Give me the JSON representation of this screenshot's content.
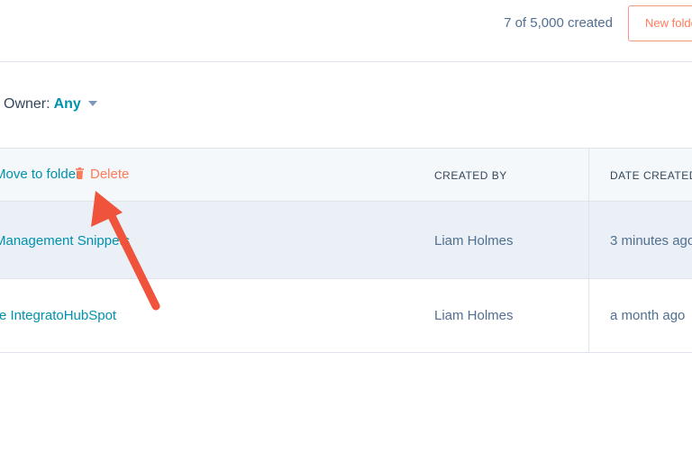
{
  "header": {
    "created_count": "7 of 5,000 created",
    "new_folder_label": "New folder"
  },
  "filters": {
    "owner_label": "Owner:",
    "owner_value": "Any"
  },
  "bulk_actions": {
    "move_to_folder_label": "Move to folder",
    "delete_label": "Delete"
  },
  "table": {
    "columns": [
      "CREATED BY",
      "DATE CREATED"
    ],
    "rows": [
      {
        "name": "Management Snippets",
        "created_by": "Liam Holmes",
        "date_created": "3 minutes ago"
      },
      {
        "name": "re IntegratoHubSpot",
        "created_by": "Liam Holmes",
        "date_created": "a month ago"
      }
    ]
  },
  "annotation": {
    "arrow_color": "#f0533c"
  }
}
